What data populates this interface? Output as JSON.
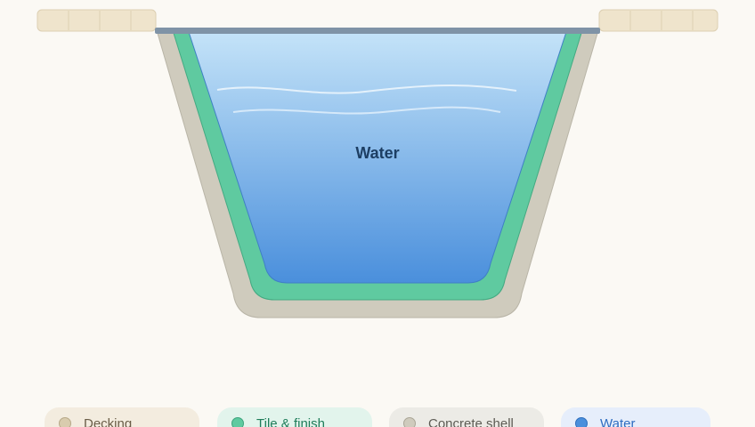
{
  "diagram": {
    "water_label": "Water"
  },
  "legend": {
    "items": [
      {
        "label": "Decking",
        "color": "#d9ccae"
      },
      {
        "label": "Tile & finish",
        "color": "#5fcaa0"
      },
      {
        "label": "Concrete shell",
        "color": "#cfcbbd"
      },
      {
        "label": "Water",
        "color": "#4a8fdc"
      }
    ]
  },
  "colors": {
    "background": "#fbf9f4",
    "decking": "#efe4cc",
    "concrete": "#cfcbbd",
    "tile": "#5fcaa0",
    "water_top": "#bfe0f7",
    "water_bottom": "#4a8fdc",
    "coping": "#7f93a6",
    "label": "#1d3e63"
  }
}
